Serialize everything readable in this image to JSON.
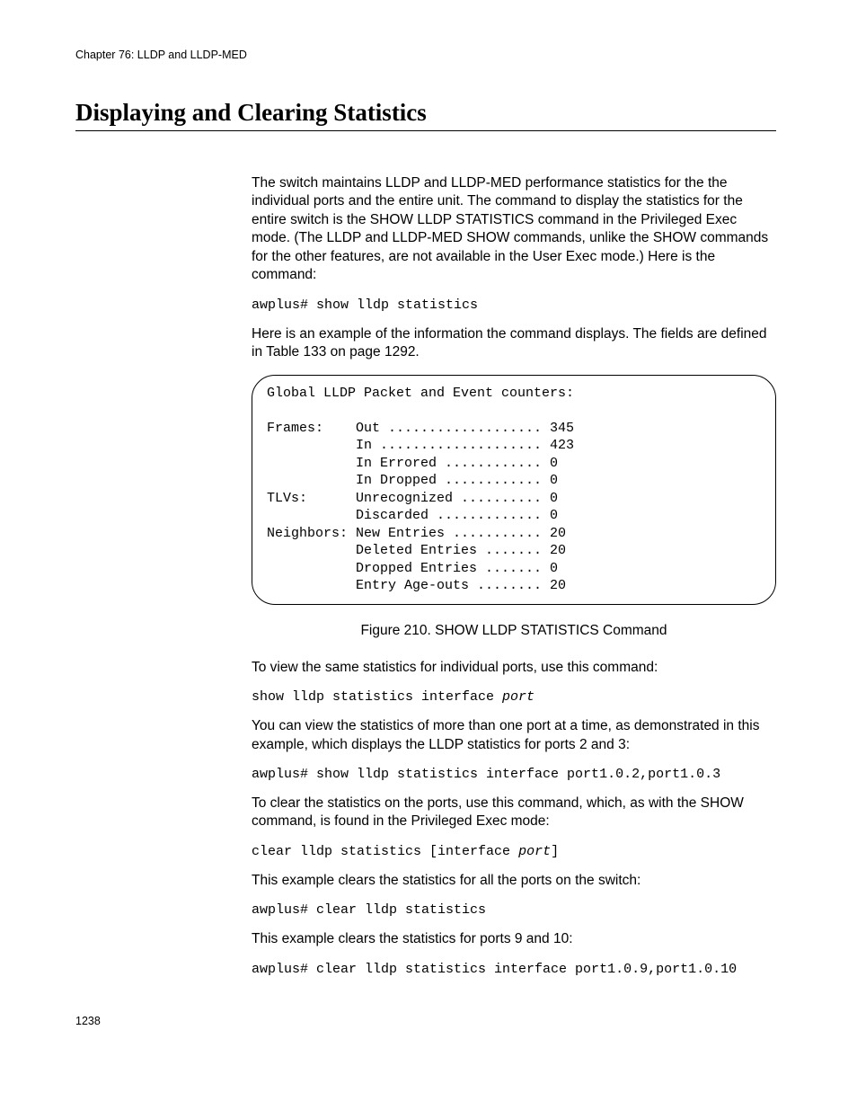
{
  "header": {
    "chapter": "Chapter 76: LLDP and LLDP-MED"
  },
  "section": {
    "title": "Displaying and Clearing Statistics"
  },
  "body": {
    "p1": "The switch maintains LLDP and LLDP-MED performance statistics for the the individual ports and the entire unit. The command to display the statistics for the entire switch is the SHOW LLDP STATISTICS command in the Privileged Exec mode. (The LLDP and LLDP-MED SHOW commands, unlike the SHOW commands for the other features, are not available in the User Exec mode.) Here is the command:",
    "cmd1": "awplus# show lldp statistics",
    "p2": "Here is an example of the information the command displays. The fields are defined in Table 133 on page 1292.",
    "output": "Global LLDP Packet and Event counters:\n\nFrames:    Out ................... 345\n           In .................... 423\n           In Errored ............ 0\n           In Dropped ............ 0\nTLVs:      Unrecognized .......... 0\n           Discarded ............. 0\nNeighbors: New Entries ........... 20\n           Deleted Entries ....... 20\n           Dropped Entries ....... 0\n           Entry Age-outs ........ 20",
    "figcaption": "Figure 210. SHOW LLDP STATISTICS Command",
    "p3": "To view the same statistics for individual ports, use this command:",
    "cmd2_a": "show lldp statistics interface ",
    "cmd2_b": "port",
    "p4": "You can view the statistics of more than one port at a time, as demonstrated in this example, which displays the LLDP statistics for ports 2 and 3:",
    "cmd3": "awplus# show lldp statistics interface port1.0.2,port1.0.3",
    "p5": "To clear the statistics on the ports, use this command, which, as with the SHOW command, is found in the Privileged Exec mode:",
    "cmd4_a": "clear lldp statistics [interface ",
    "cmd4_b": "port",
    "cmd4_c": "]",
    "p6": "This example clears the statistics for all the ports on the switch:",
    "cmd5": "awplus# clear lldp statistics",
    "p7": "This example clears the statistics for ports 9 and 10:",
    "cmd6": "awplus# clear lldp statistics interface port1.0.9,port1.0.10"
  },
  "footer": {
    "page": "1238"
  }
}
